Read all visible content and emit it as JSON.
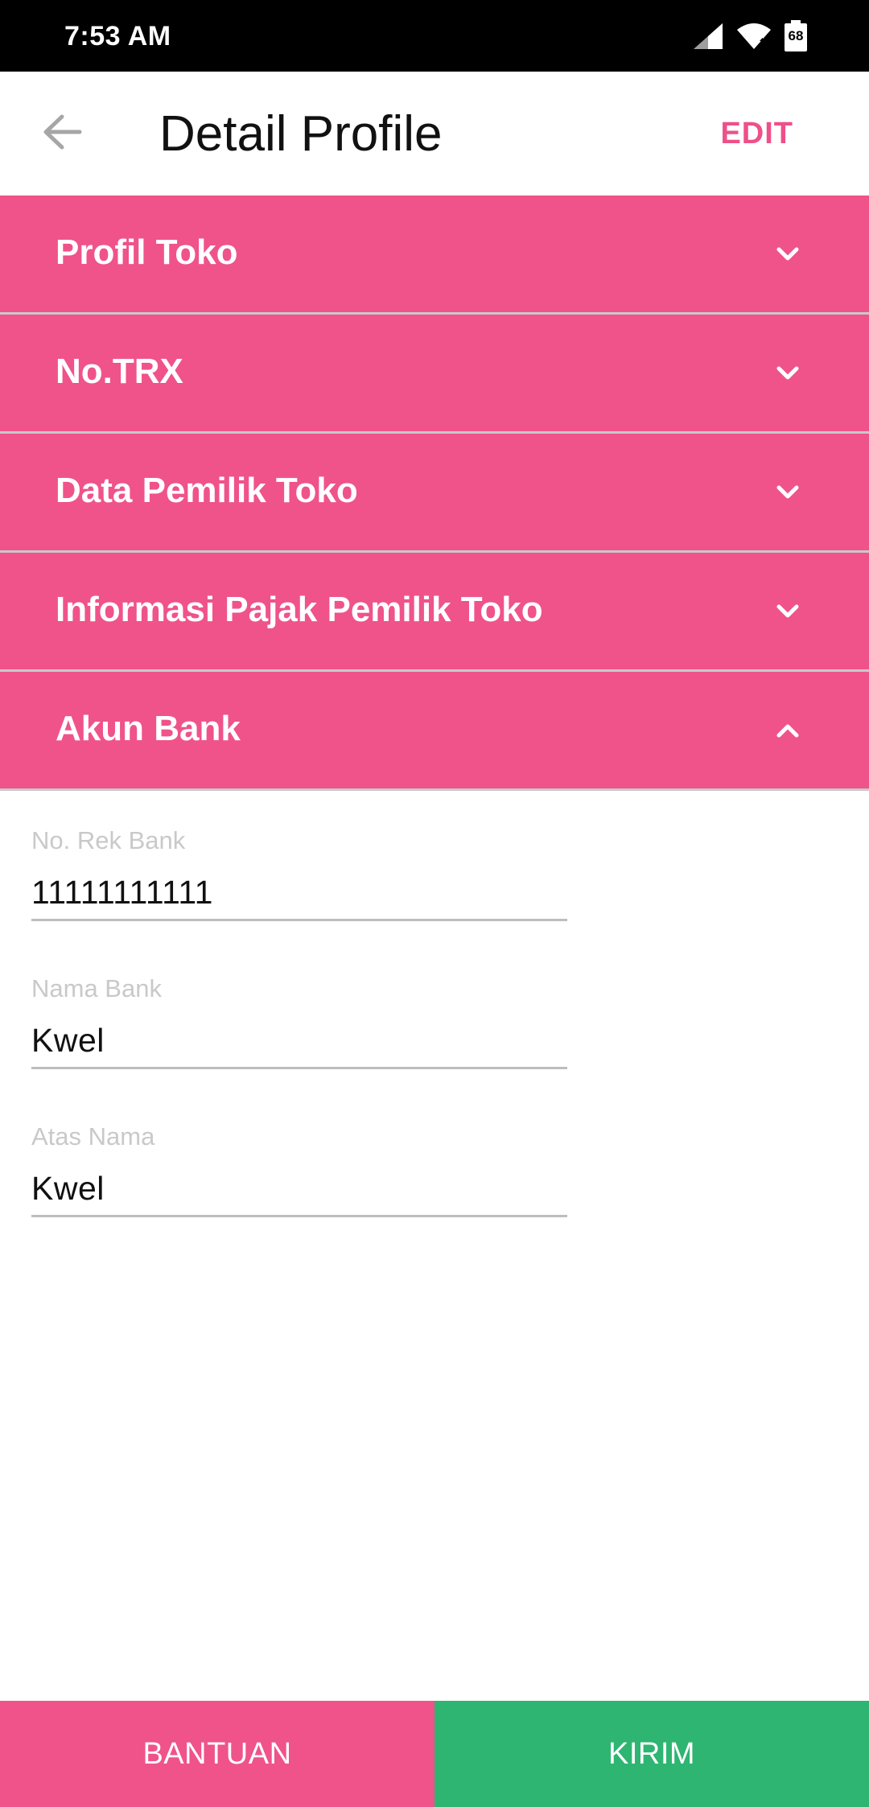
{
  "status_bar": {
    "time": "7:53 AM",
    "battery_level": "68",
    "icons": [
      "signal-icon",
      "wifi-icon",
      "battery-icon"
    ]
  },
  "app_bar": {
    "back_icon": "arrow-back-icon",
    "title": "Detail Profile",
    "edit_label": "EDIT"
  },
  "accordion": {
    "sections": [
      {
        "label": "Profil Toko",
        "expanded": false
      },
      {
        "label": "No.TRX",
        "expanded": false
      },
      {
        "label": "Data Pemilik Toko",
        "expanded": false
      },
      {
        "label": "Informasi Pajak Pemilik Toko",
        "expanded": false
      },
      {
        "label": "Akun Bank",
        "expanded": true
      }
    ]
  },
  "bank_account": {
    "fields": [
      {
        "label": "No. Rek Bank",
        "value": "11111111111"
      },
      {
        "label": "Nama Bank",
        "value": "Kwel"
      },
      {
        "label": "Atas Nama",
        "value": "Kwel"
      }
    ]
  },
  "bottom_bar": {
    "help_label": "BANTUAN",
    "send_label": "KIRIM"
  },
  "colors": {
    "accent_pink": "#ef5389",
    "send_green": "#2db571",
    "edit_pink": "#ee5089"
  }
}
